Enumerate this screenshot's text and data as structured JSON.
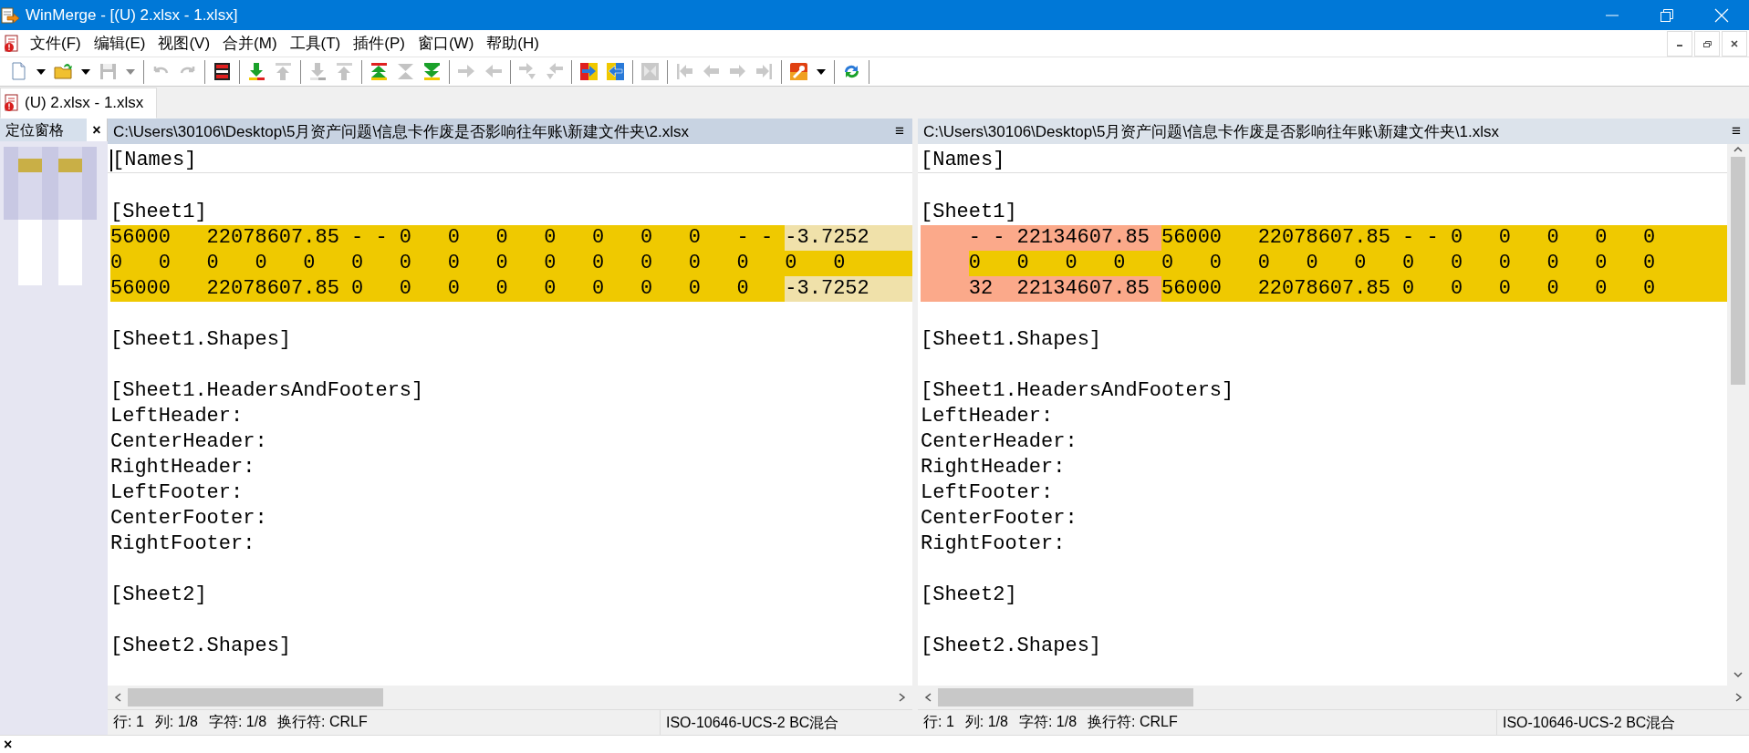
{
  "window": {
    "title": "WinMerge - [(U) 2.xlsx - 1.xlsx]"
  },
  "menu": [
    "文件(F)",
    "编辑(E)",
    "视图(V)",
    "合并(M)",
    "工具(T)",
    "插件(P)",
    "窗口(W)",
    "帮助(H)"
  ],
  "toolbar": [
    {
      "kind": "new",
      "disabled": false
    },
    {
      "kind": "dropdown",
      "disabled": false
    },
    {
      "kind": "open",
      "disabled": false
    },
    {
      "kind": "dropdown",
      "disabled": false
    },
    {
      "kind": "save",
      "disabled": true
    },
    {
      "kind": "dropdown",
      "disabled": true
    },
    {
      "kind": "separator"
    },
    {
      "kind": "undo",
      "disabled": true
    },
    {
      "kind": "redo",
      "disabled": true
    },
    {
      "kind": "separator"
    },
    {
      "kind": "compare",
      "disabled": false
    },
    {
      "kind": "separator"
    },
    {
      "kind": "next",
      "disabled": false
    },
    {
      "kind": "prev",
      "disabled": true
    },
    {
      "kind": "separator"
    },
    {
      "kind": "next",
      "disabled": true
    },
    {
      "kind": "prev",
      "disabled": true
    },
    {
      "kind": "separator"
    },
    {
      "kind": "first",
      "disabled": false
    },
    {
      "kind": "current",
      "disabled": true
    },
    {
      "kind": "last",
      "disabled": false
    },
    {
      "kind": "separator"
    },
    {
      "kind": "right",
      "disabled": true
    },
    {
      "kind": "left",
      "disabled": true
    },
    {
      "kind": "separator"
    },
    {
      "kind": "right-next",
      "disabled": true
    },
    {
      "kind": "left-next",
      "disabled": true
    },
    {
      "kind": "separator"
    },
    {
      "kind": "to-right",
      "disabled": false
    },
    {
      "kind": "to-left",
      "disabled": false
    },
    {
      "kind": "separator"
    },
    {
      "kind": "all",
      "disabled": true
    },
    {
      "kind": "separator"
    },
    {
      "kind": "begin",
      "disabled": true
    },
    {
      "kind": "back",
      "disabled": true
    },
    {
      "kind": "forward",
      "disabled": true
    },
    {
      "kind": "end",
      "disabled": true
    },
    {
      "kind": "separator"
    },
    {
      "kind": "options",
      "disabled": false
    },
    {
      "kind": "dropdown",
      "disabled": false
    },
    {
      "kind": "separator"
    },
    {
      "kind": "refresh",
      "disabled": false
    },
    {
      "kind": "separator"
    }
  ],
  "tabs": [
    {
      "label": "(U) 2.xlsx - 1.xlsx",
      "selected": true
    }
  ],
  "location_pane": {
    "title": "定位窗格",
    "close": "×"
  },
  "panes": [
    {
      "path": "C:\\Users\\30106\\Desktop\\5月资产问题\\信息卡作废是否影响往年账\\新建文件夹\\2.xlsx",
      "menu_glyph": "≡",
      "active": true,
      "caret": true,
      "lines": [
        {
          "kind": "text",
          "text": "[Names]"
        },
        {
          "kind": "blank"
        },
        {
          "kind": "text",
          "text": "[Sheet1]"
        },
        {
          "kind": "diff",
          "segments": [
            {
              "kind": "changed",
              "text": "56000   22078607.85 - - 0   0   0   0   0   0   0   - - "
            },
            {
              "kind": "moved",
              "text": "-3.7252"
            }
          ]
        },
        {
          "kind": "diff",
          "segments": [
            {
              "kind": "changed",
              "text": "0   0   0   0   0   0   0   0   0   0   0   0   0   0   0   0"
            }
          ]
        },
        {
          "kind": "diff",
          "segments": [
            {
              "kind": "changed",
              "text": "56000   22078607.85 0   0   0   0   0   0   0   0   0   "
            },
            {
              "kind": "moved",
              "text": "-3.7252"
            }
          ]
        },
        {
          "kind": "blank"
        },
        {
          "kind": "text",
          "text": "[Sheet1.Shapes]"
        },
        {
          "kind": "blank"
        },
        {
          "kind": "text",
          "text": "[Sheet1.HeadersAndFooters]"
        },
        {
          "kind": "text",
          "text": "LeftHeader:"
        },
        {
          "kind": "text",
          "text": "CenterHeader:"
        },
        {
          "kind": "text",
          "text": "RightHeader:"
        },
        {
          "kind": "text",
          "text": "LeftFooter:"
        },
        {
          "kind": "text",
          "text": "CenterFooter:"
        },
        {
          "kind": "text",
          "text": "RightFooter:"
        },
        {
          "kind": "blank"
        },
        {
          "kind": "text",
          "text": "[Sheet2]"
        },
        {
          "kind": "blank"
        },
        {
          "kind": "text",
          "text": "[Sheet2.Shapes]"
        }
      ],
      "status": {
        "line": "行: 1",
        "column": "列: 1/8",
        "char": "字符: 1/8",
        "eol": "换行符: CRLF",
        "encoding": "ISO-10646-UCS-2 BC混合"
      }
    },
    {
      "path": "C:\\Users\\30106\\Desktop\\5月资产问题\\信息卡作废是否影响往年账\\新建文件夹\\1.xlsx",
      "menu_glyph": "≡",
      "active": false,
      "caret": false,
      "lines": [
        {
          "kind": "text",
          "text": "[Names]"
        },
        {
          "kind": "blank"
        },
        {
          "kind": "text",
          "text": "[Sheet1]"
        },
        {
          "kind": "diff",
          "added_indent": true,
          "segments": [
            {
              "kind": "added",
              "text": "- - 22134607.85 "
            },
            {
              "kind": "changed",
              "text": "56000   22078607.85 - - 0   0   0   0   0"
            }
          ]
        },
        {
          "kind": "diff",
          "added_indent": true,
          "segments": [
            {
              "kind": "changed",
              "text": "0   0   0   0   0   0   0   0   0   0   0   0   0   0   0"
            }
          ]
        },
        {
          "kind": "diff",
          "added_indent": true,
          "segments": [
            {
              "kind": "added",
              "text": "32  22134607.85 "
            },
            {
              "kind": "changed",
              "text": "56000   22078607.85 0   0   0   0   0   0"
            }
          ]
        },
        {
          "kind": "blank"
        },
        {
          "kind": "text",
          "text": "[Sheet1.Shapes]"
        },
        {
          "kind": "blank"
        },
        {
          "kind": "text",
          "text": "[Sheet1.HeadersAndFooters]"
        },
        {
          "kind": "text",
          "text": "LeftHeader:"
        },
        {
          "kind": "text",
          "text": "CenterHeader:"
        },
        {
          "kind": "text",
          "text": "RightHeader:"
        },
        {
          "kind": "text",
          "text": "LeftFooter:"
        },
        {
          "kind": "text",
          "text": "CenterFooter:"
        },
        {
          "kind": "text",
          "text": "RightFooter:"
        },
        {
          "kind": "blank"
        },
        {
          "kind": "text",
          "text": "[Sheet2]"
        },
        {
          "kind": "blank"
        },
        {
          "kind": "text",
          "text": "[Sheet2.Shapes]"
        }
      ],
      "status": {
        "line": "行: 1",
        "column": "列: 1/8",
        "char": "字符: 1/8",
        "eol": "换行符: CRLF",
        "encoding": "ISO-10646-UCS-2 BC混合"
      }
    }
  ],
  "bottom_bar": {
    "close": "×"
  }
}
